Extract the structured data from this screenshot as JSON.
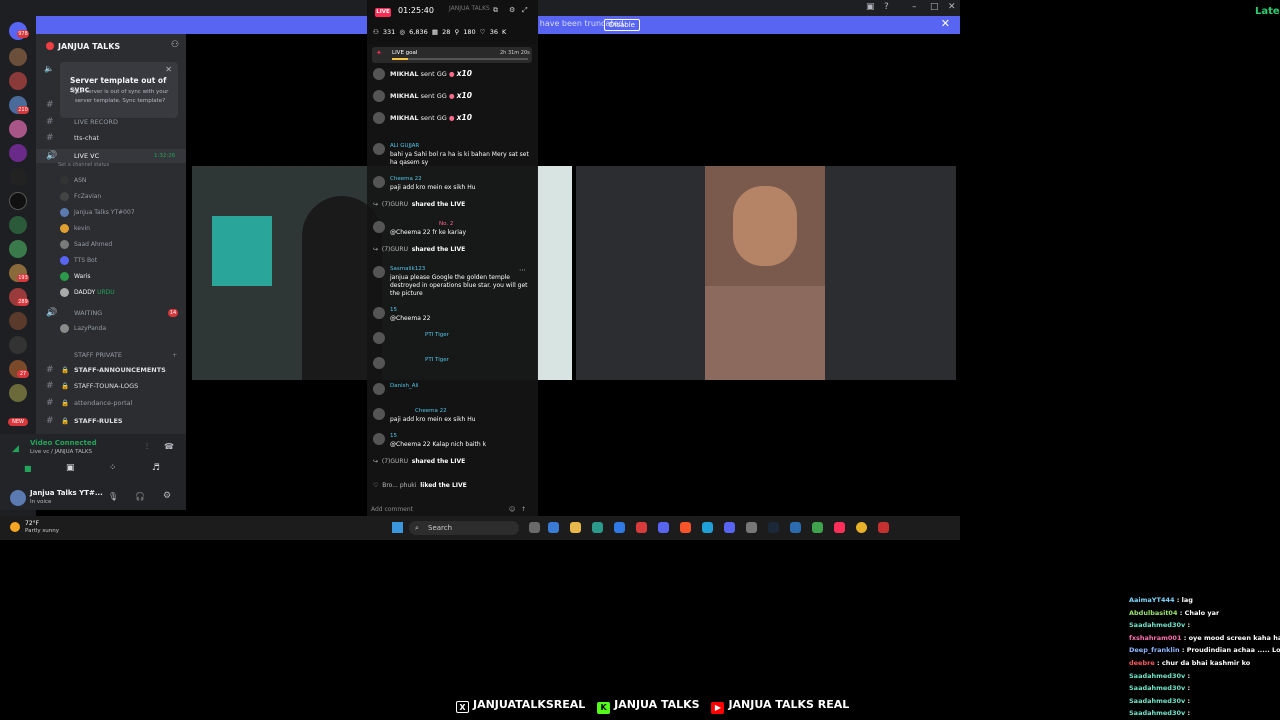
{
  "discord": {
    "banner": {
      "text": "Streamer Mode is enabled. Usernames have been truncated.",
      "disable_label": "Disable"
    },
    "server_name": "JANJUA TALKS",
    "sync_card": {
      "title": "Server template out of sync",
      "body": "Your server is out of sync with your server template. Sync template?"
    },
    "rail_badges": [
      "978",
      "1",
      "210",
      "27",
      "289",
      "193",
      "NEW"
    ],
    "channels": [
      {
        "label": "LIVE RECORD"
      },
      {
        "label": "tts-chat"
      },
      {
        "label": "LIVE VC",
        "time": "1:32:26",
        "status": "Set a channel status"
      }
    ],
    "voice_members": [
      "ASN",
      "FcZavian",
      "Janjua Talks YT#007",
      "kevin",
      "Saad Ahmed",
      "TTS Bot",
      "Waris",
      "DADDY",
      "URDU"
    ],
    "waiting": {
      "label": "WAITING",
      "member": "LazyPanda",
      "badge": "14"
    },
    "staff_category": "STAFF PRIVATE",
    "staff_channels": [
      "STAFF-ANNOUNCEMENTS",
      "STAFF-TOUNA-LOGS",
      "attendance-portal",
      "STAFF-RULES"
    ],
    "voice_connected": {
      "title": "Video Connected",
      "sub": "Live vc / JANJUA TALKS"
    },
    "user": {
      "name": "Janjua Talks YT#...",
      "status": "In voice"
    }
  },
  "weather": {
    "temp": "72°F",
    "desc": "Partly sunny"
  },
  "tiktok": {
    "live_badge": "LIVE",
    "timer": "01:25:40",
    "header_name": "JANJUA TALKS",
    "stats": [
      "331",
      "6,836",
      "28",
      "180",
      "36 K"
    ],
    "goal": {
      "label": "LIVE goal",
      "time": "2h 31m 20s"
    },
    "gifts": [
      {
        "user": "MIKHAL",
        "text": "sent GG",
        "count": "x10"
      },
      {
        "user": "MIKHAL",
        "text": "sent GG",
        "count": "x10"
      },
      {
        "user": "MIKHAL",
        "text": "sent GG",
        "count": "x10"
      }
    ],
    "messages": [
      {
        "user": "ALI GUJJAR",
        "text": "bahi ya Sahi bol ra ha is ki bahan Mery sat set ha qasem sy"
      },
      {
        "user": "Cheema 22",
        "text": "paji add kro mein ex sikh Hu"
      },
      {
        "share_user": "(7)GURU",
        "share_text": "shared the LIVE"
      },
      {
        "user": "No. 2",
        "text": "@Cheema 22 fr ke kariay"
      },
      {
        "share_user": "(7)GURU",
        "share_text": "shared the LIVE"
      },
      {
        "user": "Sasmalik123",
        "text": "janjua please Google the golden temple destroyed in operations blue star. you will get the picture"
      },
      {
        "user": "15",
        "text": "@Cheema 22"
      },
      {
        "user": "PTI Tiger",
        "text": ""
      },
      {
        "user": "PTI Tiger",
        "text": ""
      },
      {
        "user": "Danish_Ali",
        "text": ""
      },
      {
        "user": "Cheema 22",
        "text": "paji add kro mein ex sikh Hu"
      },
      {
        "user": "15",
        "text": "@Cheema 22 Kalap nich baith k"
      },
      {
        "share_user": "(7)GURU",
        "share_text": "shared the LIVE"
      },
      {
        "share_user": "Bro... phuki",
        "share_text": "liked the LIVE"
      }
    ],
    "input_placeholder": "Add comment"
  },
  "taskbar": {
    "search_label": "Search"
  },
  "corner_text": "Late",
  "right_chat": [
    {
      "user": "AaimaYT444",
      "text": ": lag",
      "color": "#7fd6ff"
    },
    {
      "user": "Abdulbasit04",
      "text": ": Chalo yar",
      "color": "#9be36b"
    },
    {
      "user": "Saadahmed30v",
      "text": ":",
      "color": "#6fe3c8"
    },
    {
      "user": "fxshahram001",
      "text": ": oye mood screen kaha ha",
      "color": "#ff6fae"
    },
    {
      "user": "Deep_franklin",
      "text": ": Proudindian achaa ..... Lol",
      "color": "#8fb8ff"
    },
    {
      "user": "deebre",
      "text": ": chur da bhai kashmir ko",
      "color": "#ff5a5a"
    },
    {
      "user": "Saadahmed30v",
      "text": ":",
      "color": "#6fe3c8"
    },
    {
      "user": "Saadahmed30v",
      "text": ":",
      "color": "#6fe3c8"
    },
    {
      "user": "Saadahmed30v",
      "text": ":",
      "color": "#6fe3c8"
    },
    {
      "user": "Saadahmed30v",
      "text": ":",
      "color": "#6fe3c8"
    }
  ],
  "socials": [
    "JANJUATALKSREAL",
    "JANJUA TALKS",
    "JANJUA TALKS REAL"
  ]
}
